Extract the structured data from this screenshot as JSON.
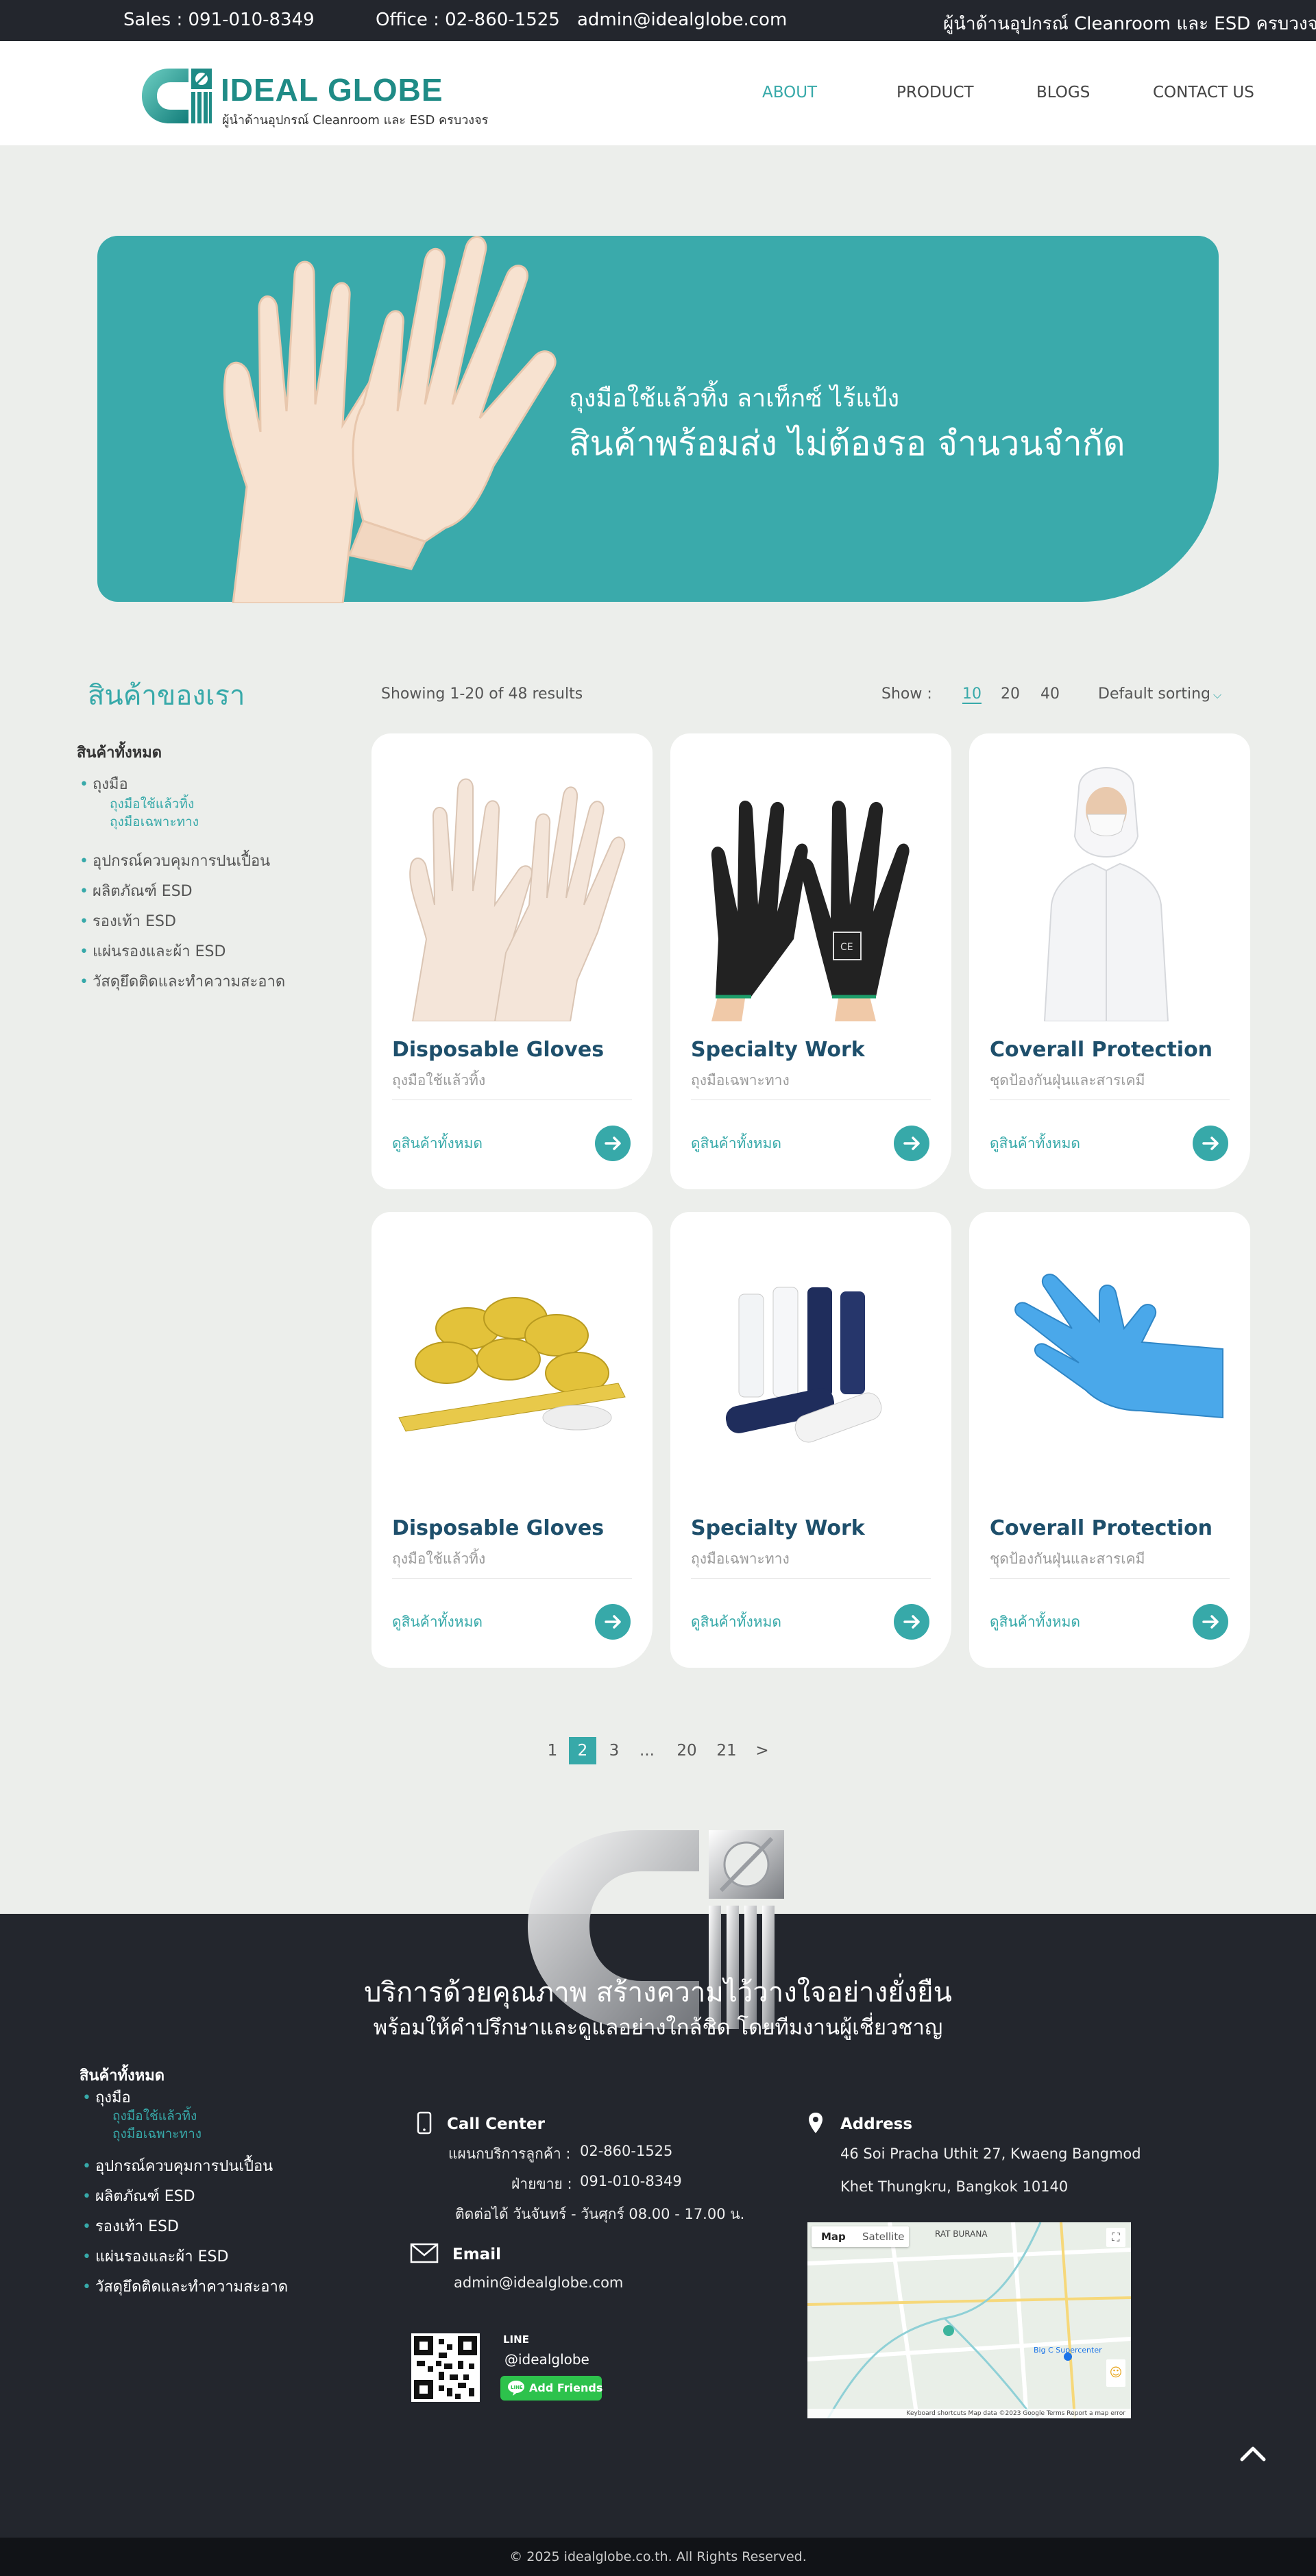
{
  "topbar": {
    "sales": "Sales :  091-010-8349",
    "office": "Office : 02-860-1525",
    "email": "admin@idealglobe.com",
    "tagline": "ผู้นำด้านอุปกรณ์ Cleanroom และ ESD ครบวงจร"
  },
  "header": {
    "logo_name": "IDEAL GLOBE",
    "logo_tagline": "ผู้นำด้านอุปกรณ์ Cleanroom และ ESD ครบวงจร",
    "nav": [
      "ABOUT",
      "PRODUCT",
      "BLOGS",
      "CONTACT US"
    ],
    "active_nav": "ABOUT"
  },
  "banner": {
    "line1": "ถุงมือใช้แล้วทิ้ง ลาเท็กซ์ ไร้แป้ง",
    "line2": "สินค้าพร้อมส่ง ไม่ต้องรอ จำนวนจำกัด"
  },
  "sidebar": {
    "title": "สินค้าของเรา",
    "all": "สินค้าทั้งหมด",
    "items": [
      "ถุงมือ",
      "อุปกรณ์ควบคุมการปนเปื้อน",
      "ผลิตภัณฑ์ ESD",
      "รองเท้า ESD",
      "แผ่นรองและผ้า ESD",
      "วัสดุยึดติดและทำความสะอาด"
    ],
    "subitems": [
      "ถุงมือใช้แล้วทิ้ง",
      "ถุงมือเฉพาะทาง"
    ]
  },
  "toolbar": {
    "results": "Showing 1-20 of 48 results",
    "show_label": "Show :",
    "show_options": [
      "10",
      "20",
      "40"
    ],
    "show_selected": "10",
    "sort": "Default sorting"
  },
  "products": [
    {
      "title": "Disposable Gloves",
      "subtitle": "ถุงมือใช้แล้วทิ้ง",
      "link": "ดูสินค้าทั้งหมด",
      "image": "clear-gloves"
    },
    {
      "title": "Specialty Work",
      "subtitle": "ถุงมือเฉพาะทาง",
      "link": "ดูสินค้าทั้งหมด",
      "image": "black-work-gloves"
    },
    {
      "title": "Coverall Protection",
      "subtitle": "ชุดป้องกันฝุ่นและสารเคมี",
      "link": "ดูสินค้าทั้งหมด",
      "image": "white-coverall"
    },
    {
      "title": "Disposable Gloves",
      "subtitle": "ถุงมือใช้แล้วทิ้ง",
      "link": "ดูสินค้าทั้งหมด",
      "image": "esd-tape"
    },
    {
      "title": "Specialty Work",
      "subtitle": "ถุงมือเฉพาะทาง",
      "link": "ดูสินค้าทั้งหมด",
      "image": "film-rolls"
    },
    {
      "title": "Coverall Protection",
      "subtitle": "ชุดป้องกันฝุ่นและสารเคมี",
      "link": "ดูสินค้าทั้งหมด",
      "image": "blue-nitrile-glove"
    }
  ],
  "pagination": {
    "pages": [
      "1",
      "2",
      "3",
      "...",
      "20",
      "21",
      ">"
    ],
    "current": "2"
  },
  "footer": {
    "headline": "บริการด้วยคุณภาพ สร้างความไว้วางใจอย่างยั่งยืน",
    "subheadline": "พร้อมให้คำปรึกษาและดูแลอย่างใกล้ชิด โดยทีมงานผู้เชี่ยวชาญ",
    "all": "สินค้าทั้งหมด",
    "call_center": {
      "title": "Call Center",
      "customer_label": "แผนกบริการลูกค้า :",
      "customer_value": "02-860-1525",
      "sales_label": "ฝ่ายขาย :",
      "sales_value": "091-010-8349",
      "hours": "ติดต่อได้ วันจันทร์ - วันศุกร์ 08.00 - 17.00 น."
    },
    "email": {
      "title": "Email",
      "value": "admin@idealglobe.com"
    },
    "line": {
      "label": "LINE",
      "id": "@idealglobe",
      "button": "Add Friends"
    },
    "address": {
      "title": "Address",
      "line1": "46 Soi Pracha Uthit 27, Kwaeng Bangmod",
      "line2": "Khet Thungkru, Bangkok 10140"
    },
    "map": {
      "tab_map": "Map",
      "tab_satellite": "Satellite",
      "label_area": "RAT BURANA",
      "label_poi": "Big C Supercenter",
      "footer": "Keyboard shortcuts   Map data ©2023 Google   Terms   Report a map error"
    },
    "copyright": "© 2025 idealglobe.co.th. All Rights Reserved."
  },
  "colors": {
    "accent": "#37a9a9",
    "dark": "#23262d",
    "bg": "#eceeeb",
    "title": "#1e4f6b"
  }
}
